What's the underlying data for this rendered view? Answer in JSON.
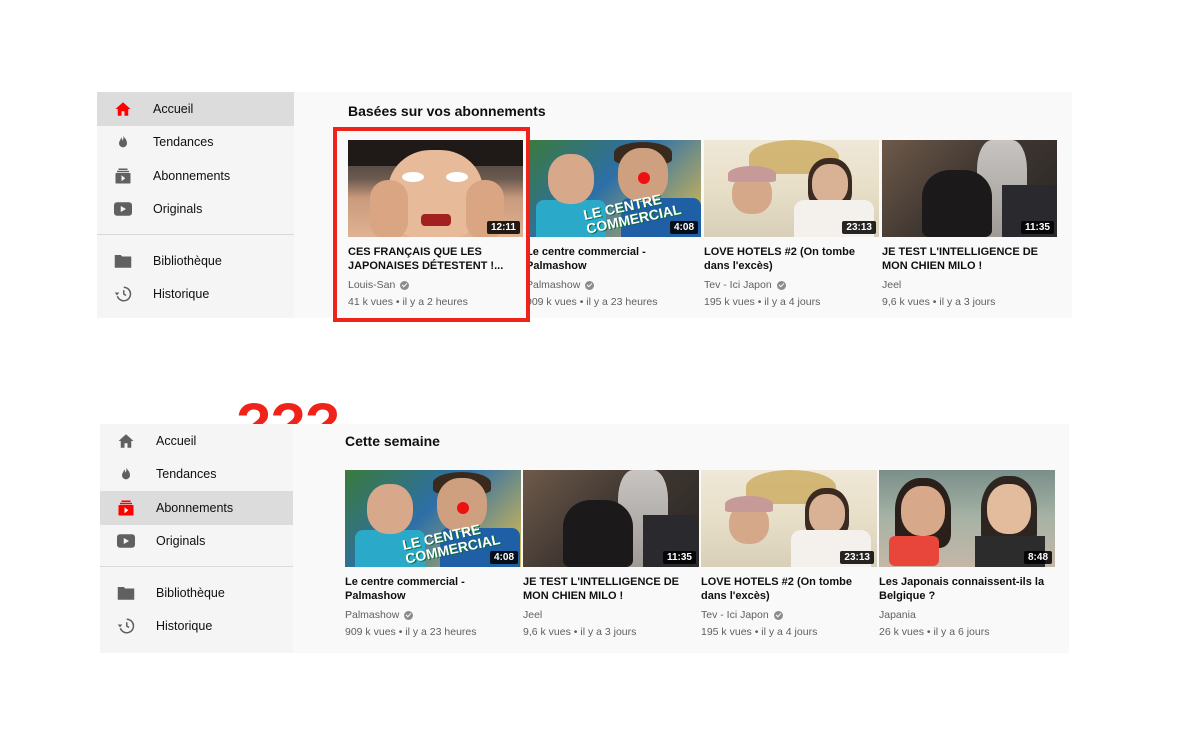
{
  "annotation": {
    "text": "???",
    "color": "#f0231b"
  },
  "panel_top": {
    "sidebar": {
      "items": [
        {
          "label": "Accueil",
          "icon": "home-icon",
          "active": true
        },
        {
          "label": "Tendances",
          "icon": "flame-icon",
          "active": false
        },
        {
          "label": "Abonnements",
          "icon": "subscriptions-icon",
          "active": false
        },
        {
          "label": "Originals",
          "icon": "youtube-play-icon",
          "active": false
        }
      ],
      "library": [
        {
          "label": "Bibliothèque",
          "icon": "folder-icon"
        },
        {
          "label": "Historique",
          "icon": "history-icon"
        }
      ]
    },
    "section_title": "Basées sur vos abonnements",
    "videos": [
      {
        "title": "CES FRANÇAIS QUE LES JAPONAISES DÉTESTENT !...",
        "channel": "Louis-San",
        "verified": true,
        "meta": "41 k vues • il y a 2 heures",
        "duration": "12:11"
      },
      {
        "title": "Le centre commercial - Palmashow",
        "channel": "Palmashow",
        "verified": true,
        "meta": "909 k vues • il y a 23 heures",
        "duration": "4:08"
      },
      {
        "title": "LOVE HOTELS #2 (On tombe dans l'excès)",
        "channel": "Tev - Ici Japon",
        "verified": true,
        "meta": "195 k vues • il y a 4 jours",
        "duration": "23:13"
      },
      {
        "title": "JE TEST L'INTELLIGENCE DE MON CHIEN MILO !",
        "channel": "Jeel",
        "verified": false,
        "meta": "9,6 k vues • il y a 3 jours",
        "duration": "11:35"
      }
    ]
  },
  "panel_bottom": {
    "sidebar": {
      "items": [
        {
          "label": "Accueil",
          "icon": "home-icon",
          "active": false
        },
        {
          "label": "Tendances",
          "icon": "flame-icon",
          "active": false
        },
        {
          "label": "Abonnements",
          "icon": "subscriptions-icon",
          "active": true
        },
        {
          "label": "Originals",
          "icon": "youtube-play-icon",
          "active": false
        }
      ],
      "library": [
        {
          "label": "Bibliothèque",
          "icon": "folder-icon"
        },
        {
          "label": "Historique",
          "icon": "history-icon"
        }
      ]
    },
    "section_title": "Cette semaine",
    "videos": [
      {
        "title": "Le centre commercial - Palmashow",
        "channel": "Palmashow",
        "verified": true,
        "meta": "909 k vues • il y a 23 heures",
        "duration": "4:08"
      },
      {
        "title": "JE TEST L'INTELLIGENCE DE MON CHIEN MILO !",
        "channel": "Jeel",
        "verified": false,
        "meta": "9,6 k vues • il y a 3 jours",
        "duration": "11:35"
      },
      {
        "title": "LOVE HOTELS #2 (On tombe dans l'excès)",
        "channel": "Tev - Ici Japon",
        "verified": true,
        "meta": "195 k vues • il y a 4 jours",
        "duration": "23:13"
      },
      {
        "title": "Les Japonais connaissent-ils la Belgique ?",
        "channel": "Japania",
        "verified": false,
        "meta": "26 k vues • il y a 6 jours",
        "duration": "8:48"
      }
    ]
  },
  "colors": {
    "accent_red": "#f0231b",
    "active_bg": "#dcdcdc",
    "sidebar_bg": "#f5f5f5",
    "meta_text": "#606060"
  }
}
